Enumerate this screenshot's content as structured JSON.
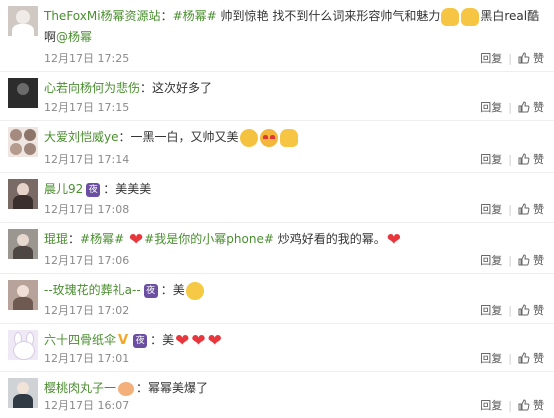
{
  "actions": {
    "reply": "回复",
    "separator": "|",
    "like": "赞"
  },
  "comments": [
    {
      "user": "TheFoxMi杨幂资源站",
      "colon": "：",
      "tag": "#杨幂#",
      "text": " 帅到惊艳 找不到什么词来形容帅气和魅力",
      "text2": "黑白real酷啊",
      "mention": "@杨幂",
      "time": "12月17日 17:25",
      "emojis": [
        "pray-icon",
        "pray-icon"
      ],
      "avatar_color": "#cfc8c3"
    },
    {
      "user": "心若向杨何为悲伤",
      "colon": "：",
      "text": "这次好多了",
      "time": "12月17日 17:15",
      "avatar_color": "#2c2c2c"
    },
    {
      "user": "大爱刘恺威ye",
      "colon": "：",
      "text": "一黑一白，又帅又美",
      "time": "12月17日 17:14",
      "emojis": [
        "laughing-icon",
        "heart-eyes-icon",
        "pray-icon"
      ],
      "avatar_color": "#dcc9c1"
    },
    {
      "user": "晨儿92",
      "badge": "夜",
      "colon": "：",
      "text": "美美美",
      "time": "12月17日 17:08",
      "avatar_color": "#7a6a66"
    },
    {
      "user": "琨琨",
      "colon": "：",
      "tag": "#杨幂#",
      "tag2": "#我是你的小幂phone#",
      "text": " 炒鸡好看的我的幂。",
      "time": "12月17日 17:06",
      "avatar_color": "#9c9691"
    },
    {
      "user": "--玫瑰花的葬礼a--",
      "badge": "夜",
      "colon": "：",
      "text": "美",
      "time": "12月17日 17:02",
      "avatar_color": "#b7a39a"
    },
    {
      "user": "六十四骨纸伞",
      "vip": "V",
      "badge": "夜",
      "colon": "：",
      "text": "美",
      "time": "12月17日 17:01",
      "avatar_color": "#e9e2f2"
    },
    {
      "user": "樱桃肉丸子一",
      "colon": "：",
      "text": "幂幂美爆了",
      "time": "12月17日 16:07",
      "avatar_color": "#cfd3d6"
    }
  ]
}
